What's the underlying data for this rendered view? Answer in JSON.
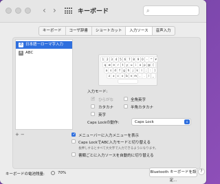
{
  "window": {
    "title": "キーボード",
    "nav_back": "‹",
    "nav_forward": "›"
  },
  "tabs": [
    {
      "label": "キーボード",
      "active": false
    },
    {
      "label": "コーザ辞書",
      "active": false
    },
    {
      "label": "ショートカット",
      "active": false
    },
    {
      "label": "入力ソース",
      "active": true
    },
    {
      "label": "音声入力",
      "active": false
    }
  ],
  "input_sources": [
    {
      "badge": "あ",
      "label": "日本語－ローマ字入力",
      "selected": true
    },
    {
      "badge": "A",
      "label": "ABC",
      "selected": false
    }
  ],
  "keyboard": {
    "rows": [
      [
        "1",
        "2",
        "3",
        "4",
        "5",
        "6",
        "7",
        "8",
        "9",
        "0",
        "-",
        "^",
        "¥"
      ],
      [
        "q",
        "w",
        "e",
        "r",
        "t",
        "y",
        "u",
        "i",
        "o",
        "p",
        "@",
        "["
      ],
      [
        "a",
        "s",
        "d",
        "f",
        "g",
        "h",
        "j",
        "k",
        "l",
        ";",
        ":",
        "]"
      ],
      [
        "z",
        "x",
        "c",
        "v",
        "b",
        "n",
        "m",
        ",",
        ".",
        "/",
        "_"
      ]
    ]
  },
  "input_modes": {
    "heading": "入力モード:",
    "options": [
      {
        "label": "ひらがな",
        "checked": true,
        "disabled": true
      },
      {
        "label": "全角英字",
        "checked": false,
        "disabled": false
      },
      {
        "label": "カタカナ",
        "checked": false,
        "disabled": false
      },
      {
        "label": "半角カタカナ",
        "checked": false,
        "disabled": false
      },
      {
        "label": "英字",
        "checked": false,
        "disabled": false
      }
    ]
  },
  "caps_lock": {
    "label": "Caps Lockの動作:",
    "value": "Caps Lock"
  },
  "list_controls": {
    "add": "+",
    "remove": "−"
  },
  "options": {
    "show_menu": {
      "label": "メニューバーに入力メニューを表示",
      "checked": true
    },
    "caps_abc": {
      "label": "Caps LockでABC入力モードと切り替える",
      "checked": false,
      "description": "長押しするとすべて大文字で入力できるようになります。"
    },
    "auto_switch": {
      "label": "書類ごとに入力ソースを自動的に切り替える",
      "checked": false
    }
  },
  "footer": {
    "battery_label": "キーボードの電池残量:",
    "battery_value": "70%",
    "bluetooth_button": "Bluetooth キーボードを設定...",
    "help": "?"
  },
  "colors": {
    "accent": "#2f6fde",
    "wallpaper": "#7b46a8"
  }
}
